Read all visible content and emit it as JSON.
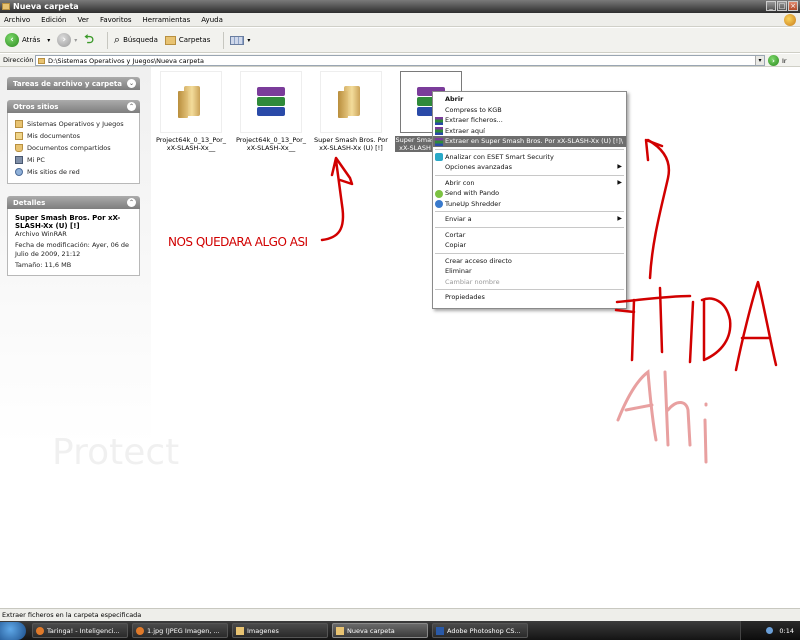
{
  "window": {
    "title": "Nueva carpeta"
  },
  "menubar": [
    "Archivo",
    "Edición",
    "Ver",
    "Favoritos",
    "Herramientas",
    "Ayuda"
  ],
  "toolbar": {
    "back": "Atrás",
    "search": "Búsqueda",
    "folders": "Carpetas"
  },
  "address": {
    "label": "Dirección",
    "path": "D:\\Sistemas Operativos y Juegos\\Nueva carpeta",
    "go": "Ir"
  },
  "sidebar": {
    "tasks_title": "Tareas de archivo y carpeta",
    "places_title": "Otros sitios",
    "places": [
      "Sistemas Operativos y Juegos",
      "Mis documentos",
      "Documentos compartidos",
      "Mi PC",
      "Mis sitios de red"
    ],
    "details_title": "Detalles",
    "details": {
      "name": "Super Smash Bros. Por xX-SLASH-Xx (U) [!]",
      "type": "Archivo WinRAR",
      "modified": "Fecha de modificación: Ayer, 06 de Julio de 2009, 21:12",
      "size": "Tamaño: 11,6 MB"
    }
  },
  "files": [
    {
      "label1": "Project64k_0_13_Por_",
      "label2": "xX-SLASH-Xx__",
      "kind": "folder"
    },
    {
      "label1": "Project64k_0_13_Por_",
      "label2": "xX-SLASH-Xx__",
      "kind": "rar"
    },
    {
      "label1": "Super Smash Bros. Por",
      "label2": "xX-SLASH-Xx (U) [!]",
      "kind": "folder"
    },
    {
      "label1": "Super Smas",
      "label2": "xX-SLASH",
      "kind": "rar"
    }
  ],
  "context_menu": {
    "open": "Abrir",
    "compress": "Compress to KGB",
    "extract_files": "Extraer ficheros...",
    "extract_here": "Extraer aquí",
    "extract_to": "Extraer en Super Smash Bros. Por xX-SLASH-Xx (U) [!]\\",
    "eset": "Analizar con ESET Smart Security",
    "advanced": "Opciones avanzadas",
    "open_with": "Abrir con",
    "pando": "Send with Pando",
    "shredder": "TuneUp Shredder",
    "send_to": "Enviar a",
    "cut": "Cortar",
    "copy": "Copiar",
    "shortcut": "Crear acceso directo",
    "delete": "Eliminar",
    "rename": "Cambiar nombre",
    "properties": "Propiedades"
  },
  "annotation": {
    "text": "NOS QUEDARA ALGO ASI"
  },
  "watermark": "Protect",
  "statusbar": {
    "text": "Extraer ficheros en la carpeta especificada"
  },
  "taskbar": {
    "tasks": [
      "Taringa! - Inteligenci...",
      "1.jpg (JPEG Imagen, ...",
      "Imagenes",
      "Nueva carpeta",
      "Adobe Photoshop CS..."
    ],
    "clock": "0:14"
  },
  "colors": {
    "annotation": "#d10000",
    "selection": "#6e6e6e",
    "panel_head": "#8f8f8f"
  }
}
